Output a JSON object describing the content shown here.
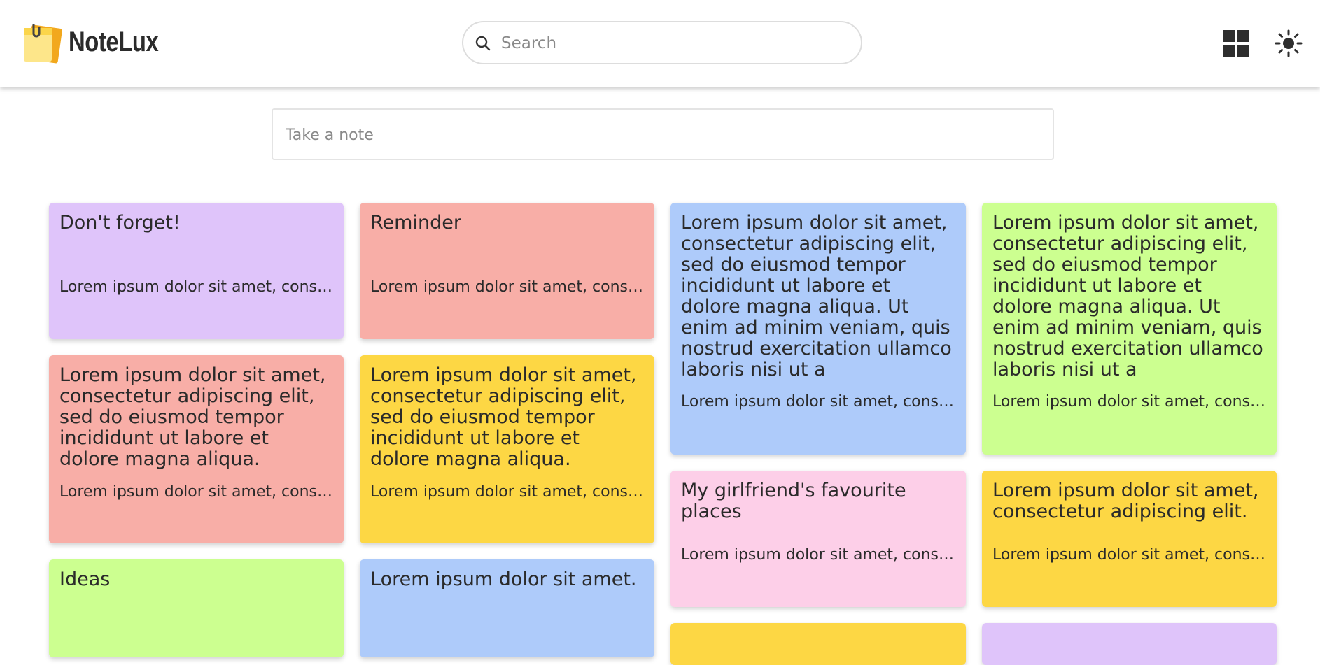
{
  "app": {
    "name": "NoteLux"
  },
  "search": {
    "placeholder": "Search"
  },
  "take_note": {
    "placeholder": "Take a note"
  },
  "icons": {
    "logo": "notes-logo-icon",
    "search": "search-icon",
    "layout": "grid-view-icon",
    "theme": "sun-icon"
  },
  "colors": {
    "purple": "#dfc4fa",
    "red": "#f8aea7",
    "blue": "#aecbfa",
    "green": "#ccff90",
    "yellow": "#fdd744",
    "pink": "#fdcfe8"
  },
  "notes": [
    {
      "title": "Don't forget!",
      "body": "Lorem ipsum dolor sit amet, consectetur adipiscing elit",
      "color": "purple"
    },
    {
      "title": "Reminder",
      "body": "Lorem ipsum dolor sit amet, consectetur adipiscing elit",
      "color": "red"
    },
    {
      "title": "Lorem ipsum dolor sit amet, consectetur adipiscing elit, sed do eiusmod tempor incididunt ut labore et dolore magna aliqua. Ut enim ad minim veniam, quis nostrud exercitation ullamco laboris nisi ut a",
      "body": "Lorem ipsum dolor sit amet, consectetur adipiscing elit",
      "color": "blue"
    },
    {
      "title": "Lorem ipsum dolor sit amet, consectetur adipiscing elit, sed do eiusmod tempor incididunt ut labore et dolore magna aliqua. Ut enim ad minim veniam, quis nostrud exercitation ullamco laboris nisi ut a",
      "body": "Lorem ipsum dolor sit amet, consectetur adipiscing elit",
      "color": "green"
    },
    {
      "title": "Lorem ipsum dolor sit amet, consectetur adipiscing elit, sed do eiusmod tempor incididunt ut labore et dolore magna aliqua.",
      "body": "Lorem ipsum dolor sit amet, consectetur adipiscing elit",
      "color": "red"
    },
    {
      "title": "Lorem ipsum dolor sit amet, consectetur adipiscing elit, sed do eiusmod tempor incididunt ut labore et dolore magna aliqua.",
      "body": "Lorem ipsum dolor sit amet, consectetur adipiscing elit",
      "color": "yellow"
    },
    {
      "title": "My girlfriend's favourite places",
      "body": "Lorem ipsum dolor sit amet, consectetur adipiscing elit",
      "color": "pink"
    },
    {
      "title": "Lorem ipsum dolor sit amet, consectetur adipiscing elit.",
      "body": "Lorem ipsum dolor sit amet, consectetur adipiscing elit",
      "color": "yellow"
    },
    {
      "title": "Ideas",
      "body": "",
      "color": "green"
    },
    {
      "title": "Lorem ipsum dolor sit amet.",
      "body": "",
      "color": "blue"
    },
    {
      "title": "",
      "body": "",
      "color": "yellow"
    },
    {
      "title": "",
      "body": "",
      "color": "purple"
    }
  ]
}
